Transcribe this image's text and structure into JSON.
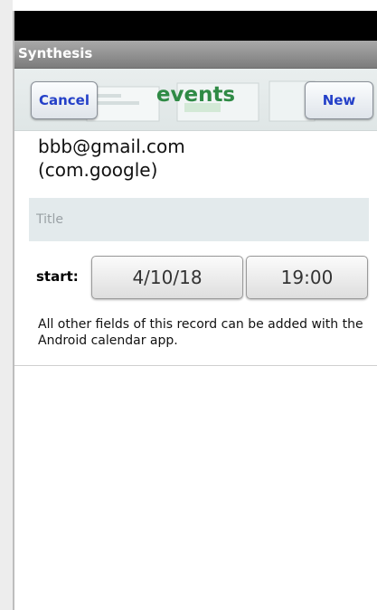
{
  "app": {
    "title": "Synthesis"
  },
  "header": {
    "cancel_label": "Cancel",
    "title": "events",
    "new_label": "New"
  },
  "account": {
    "line1": "bbb@gmail.com",
    "line2": "(com.google)"
  },
  "form": {
    "title_placeholder": "Title",
    "title_value": "",
    "start_label": "start:",
    "start_date": "4/10/18",
    "start_time": "19:00",
    "info": "All other fields of this record can be added with the Android calendar app."
  },
  "colors": {
    "accent_title": "#2f8a45",
    "button_text": "#2440c8",
    "status_bar": "#000000"
  }
}
